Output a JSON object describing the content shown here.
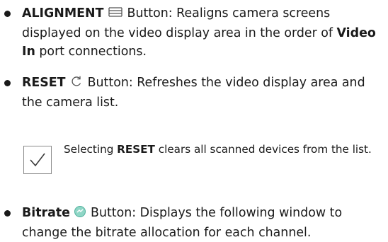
{
  "items": [
    {
      "title": "ALIGNMENT",
      "icon": "alignment-icon",
      "text_pre": "Button: Realigns camera screens displayed on the video display area in the order of ",
      "text_bold": "Video In",
      "text_post": " port connections."
    },
    {
      "title": "RESET",
      "icon": "reset-refresh-icon",
      "text": "Button: Refreshes the video display area and the camera list."
    },
    {
      "title": "Bitrate",
      "icon": "bitrate-icon",
      "icon_color": "#8fd6c6",
      "text": "Button: Displays the following window to change the bitrate allocation for each channel."
    }
  ],
  "note": {
    "icon": "checkmark-icon",
    "text_pre": "Selecting ",
    "text_bold": "RESET",
    "text_post": " clears all scanned devices from the list."
  }
}
